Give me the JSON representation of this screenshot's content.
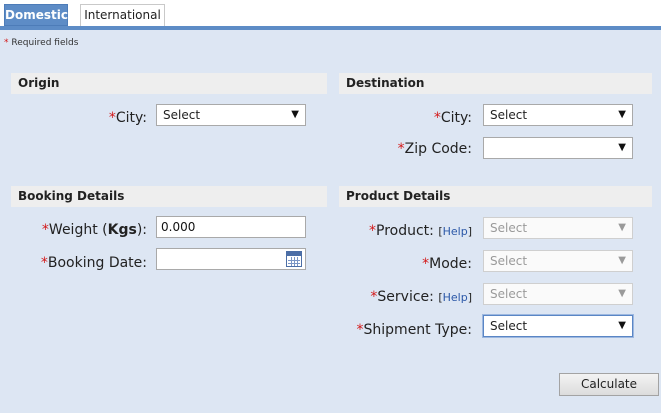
{
  "tabs": [
    {
      "label": "Domestic"
    },
    {
      "label": "International"
    }
  ],
  "required_note": "Required fields",
  "sections": {
    "origin": "Origin",
    "destination": "Destination",
    "booking": "Booking Details",
    "product": "Product Details"
  },
  "origin": {
    "city_label": "City:",
    "city_value": "Select"
  },
  "destination": {
    "city_label": "City:",
    "city_value": "Select",
    "zip_label": "Zip Code:",
    "zip_value": ""
  },
  "booking": {
    "weight_label": "Weight (",
    "weight_unit": "Kgs",
    "weight_label_end": "):",
    "weight_value": "0.000",
    "date_label": "Booking Date:",
    "date_value": ""
  },
  "product": {
    "product_label": "Product:",
    "product_help": "Help",
    "product_value": "Select",
    "mode_label": "Mode:",
    "mode_value": "Select",
    "service_label": "Service:",
    "service_help": "Help",
    "service_value": "Select",
    "shipment_label": "Shipment Type:",
    "shipment_value": "Select"
  },
  "actions": {
    "calculate": "Calculate"
  },
  "colors": {
    "background": "#dde6f3",
    "tab_active": "#5d8cc6",
    "required_star": "#d31919",
    "link": "#2a57a7"
  }
}
